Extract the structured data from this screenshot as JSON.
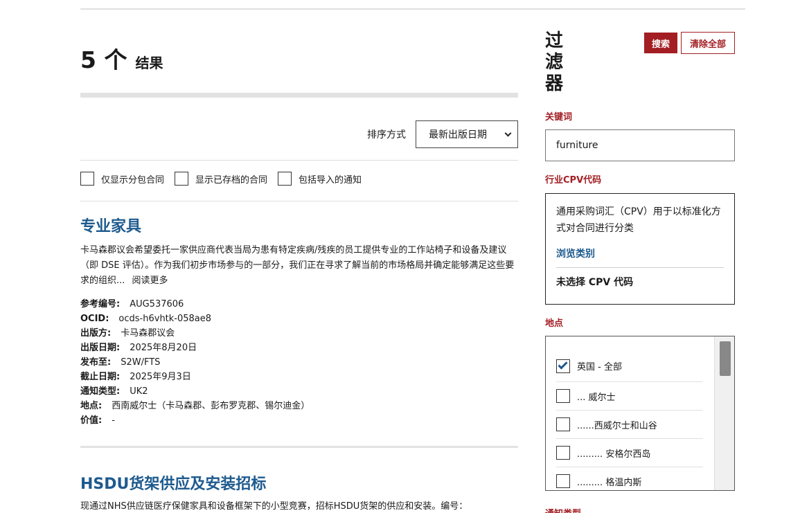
{
  "results": {
    "count": "5 个",
    "word": "结果"
  },
  "sort": {
    "label": "排序方式",
    "selected": "最新出版日期"
  },
  "toggles": [
    {
      "label": "仅显示分包合同",
      "checked": false
    },
    {
      "label": "显示已存档的合同",
      "checked": false
    },
    {
      "label": "包括导入的通知",
      "checked": false
    }
  ],
  "result1": {
    "title": "专业家具",
    "description": "卡马森郡议会希望委托一家供应商代表当局为患有特定疾病/残疾的员工提供专业的工作站椅子和设备及建议（即 DSE 评估）。作为我们初步市场参与的一部分，我们正在寻求了解当前的市场格局并确定能够满足这些要求的组织...",
    "read_more": "阅读更多",
    "meta": [
      {
        "key": "参考编号:",
        "value": "AUG537606"
      },
      {
        "key": "OCID:",
        "value": "ocds-h6vhtk-058ae8"
      },
      {
        "key": "出版方:",
        "value": "卡马森郡议会"
      },
      {
        "key": "出版日期:",
        "value": "2025年8月20日"
      },
      {
        "key": "发布至:",
        "value": "S2W/FTS"
      },
      {
        "key": "截止日期:",
        "value": "2025年9月3日"
      },
      {
        "key": "通知类型:",
        "value": "UK2"
      },
      {
        "key": "地点:",
        "value": "西南威尔士（卡马森郡、彭布罗克郡、锡尔迪金）"
      },
      {
        "key": "价值:",
        "value": "-"
      }
    ]
  },
  "result2": {
    "title": "HSDU货架供应及安装招标",
    "description": "现通过NHS供应链医疗保健家具和设备框架下的小型竞赛，招标HSDU货架的供应和安装。编号："
  },
  "filters": {
    "title": "过滤器",
    "search_button": "搜索",
    "clear_button": "清除全部",
    "keyword_label": "关键词",
    "keyword_value": "furniture",
    "cpv_label": "行业CPV代码",
    "cpv_description": "通用采购词汇（CPV）用于以标准化方式对合同进行分类",
    "cpv_browse": "浏览类别",
    "cpv_none": "未选择 CPV 代码",
    "location_label": "地点",
    "locations": [
      {
        "label": "英国 - 全部",
        "checked": true
      },
      {
        "label": "... 威尔士",
        "checked": false
      },
      {
        "label": "......西威尔士和山谷",
        "checked": false
      },
      {
        "label": "......... 安格尔西岛",
        "checked": false
      },
      {
        "label": "......... 格温内斯",
        "checked": false
      }
    ],
    "notice_type_label": "通知类型"
  },
  "colors": {
    "accent_red": "#a21e23",
    "link_blue": "#1d5a8e"
  }
}
